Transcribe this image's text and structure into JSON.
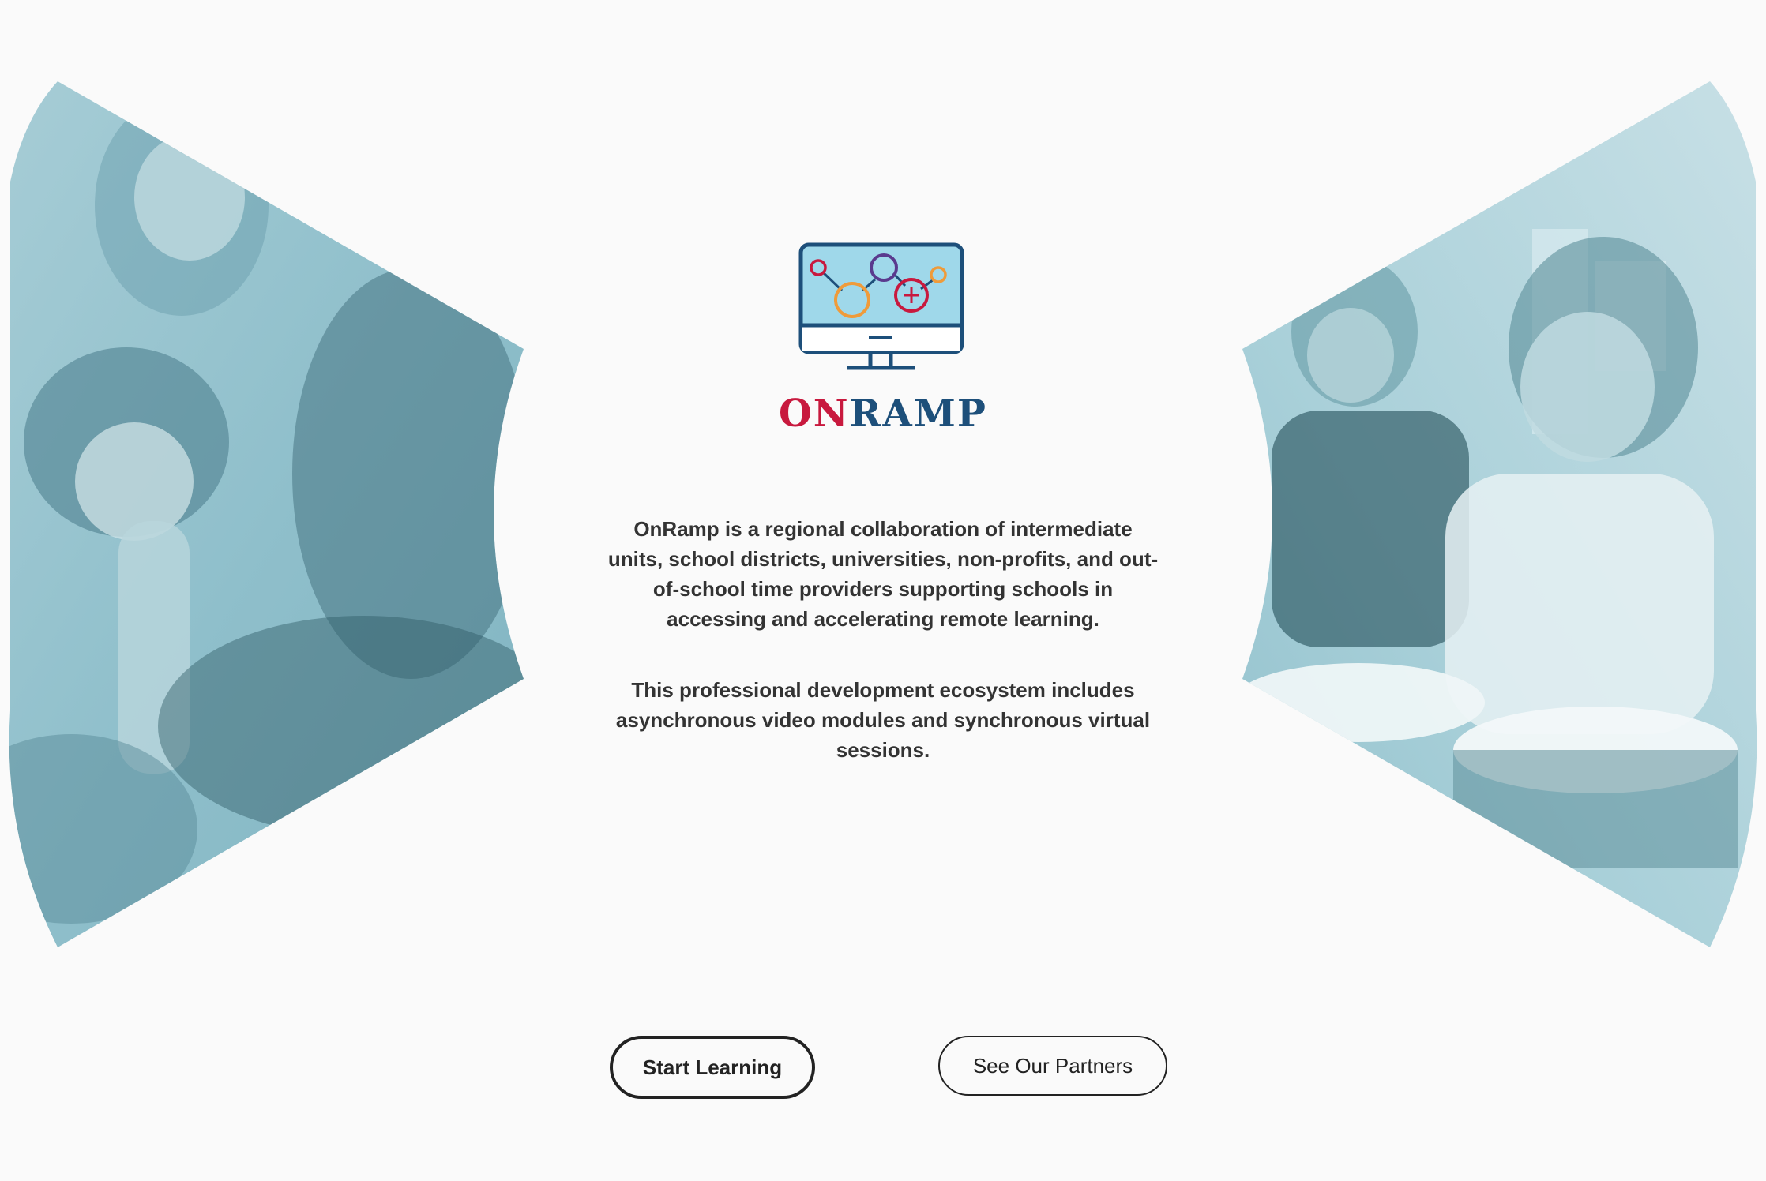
{
  "brand": {
    "name_part_1": "ON",
    "name_part_2": "RAMP",
    "logo_icon": "computer-monitor-network-icon"
  },
  "intro": {
    "paragraph_1": "OnRamp is a regional collaboration of intermediate units, school districts, universities, non-profits, and out-of-school time providers supporting schools in accessing and accelerating remote learning.",
    "paragraph_2": "This professional development ecosystem includes asynchronous video modules and synchronous virtual sessions."
  },
  "actions": {
    "start_learning": "Start Learning",
    "see_partners": "See Our Partners"
  },
  "colors": {
    "background": "#fafafa",
    "photo_tint": "#8fbfcb",
    "brand_red": "#c8193e",
    "brand_navy": "#1d4f7a",
    "text": "#333333"
  }
}
